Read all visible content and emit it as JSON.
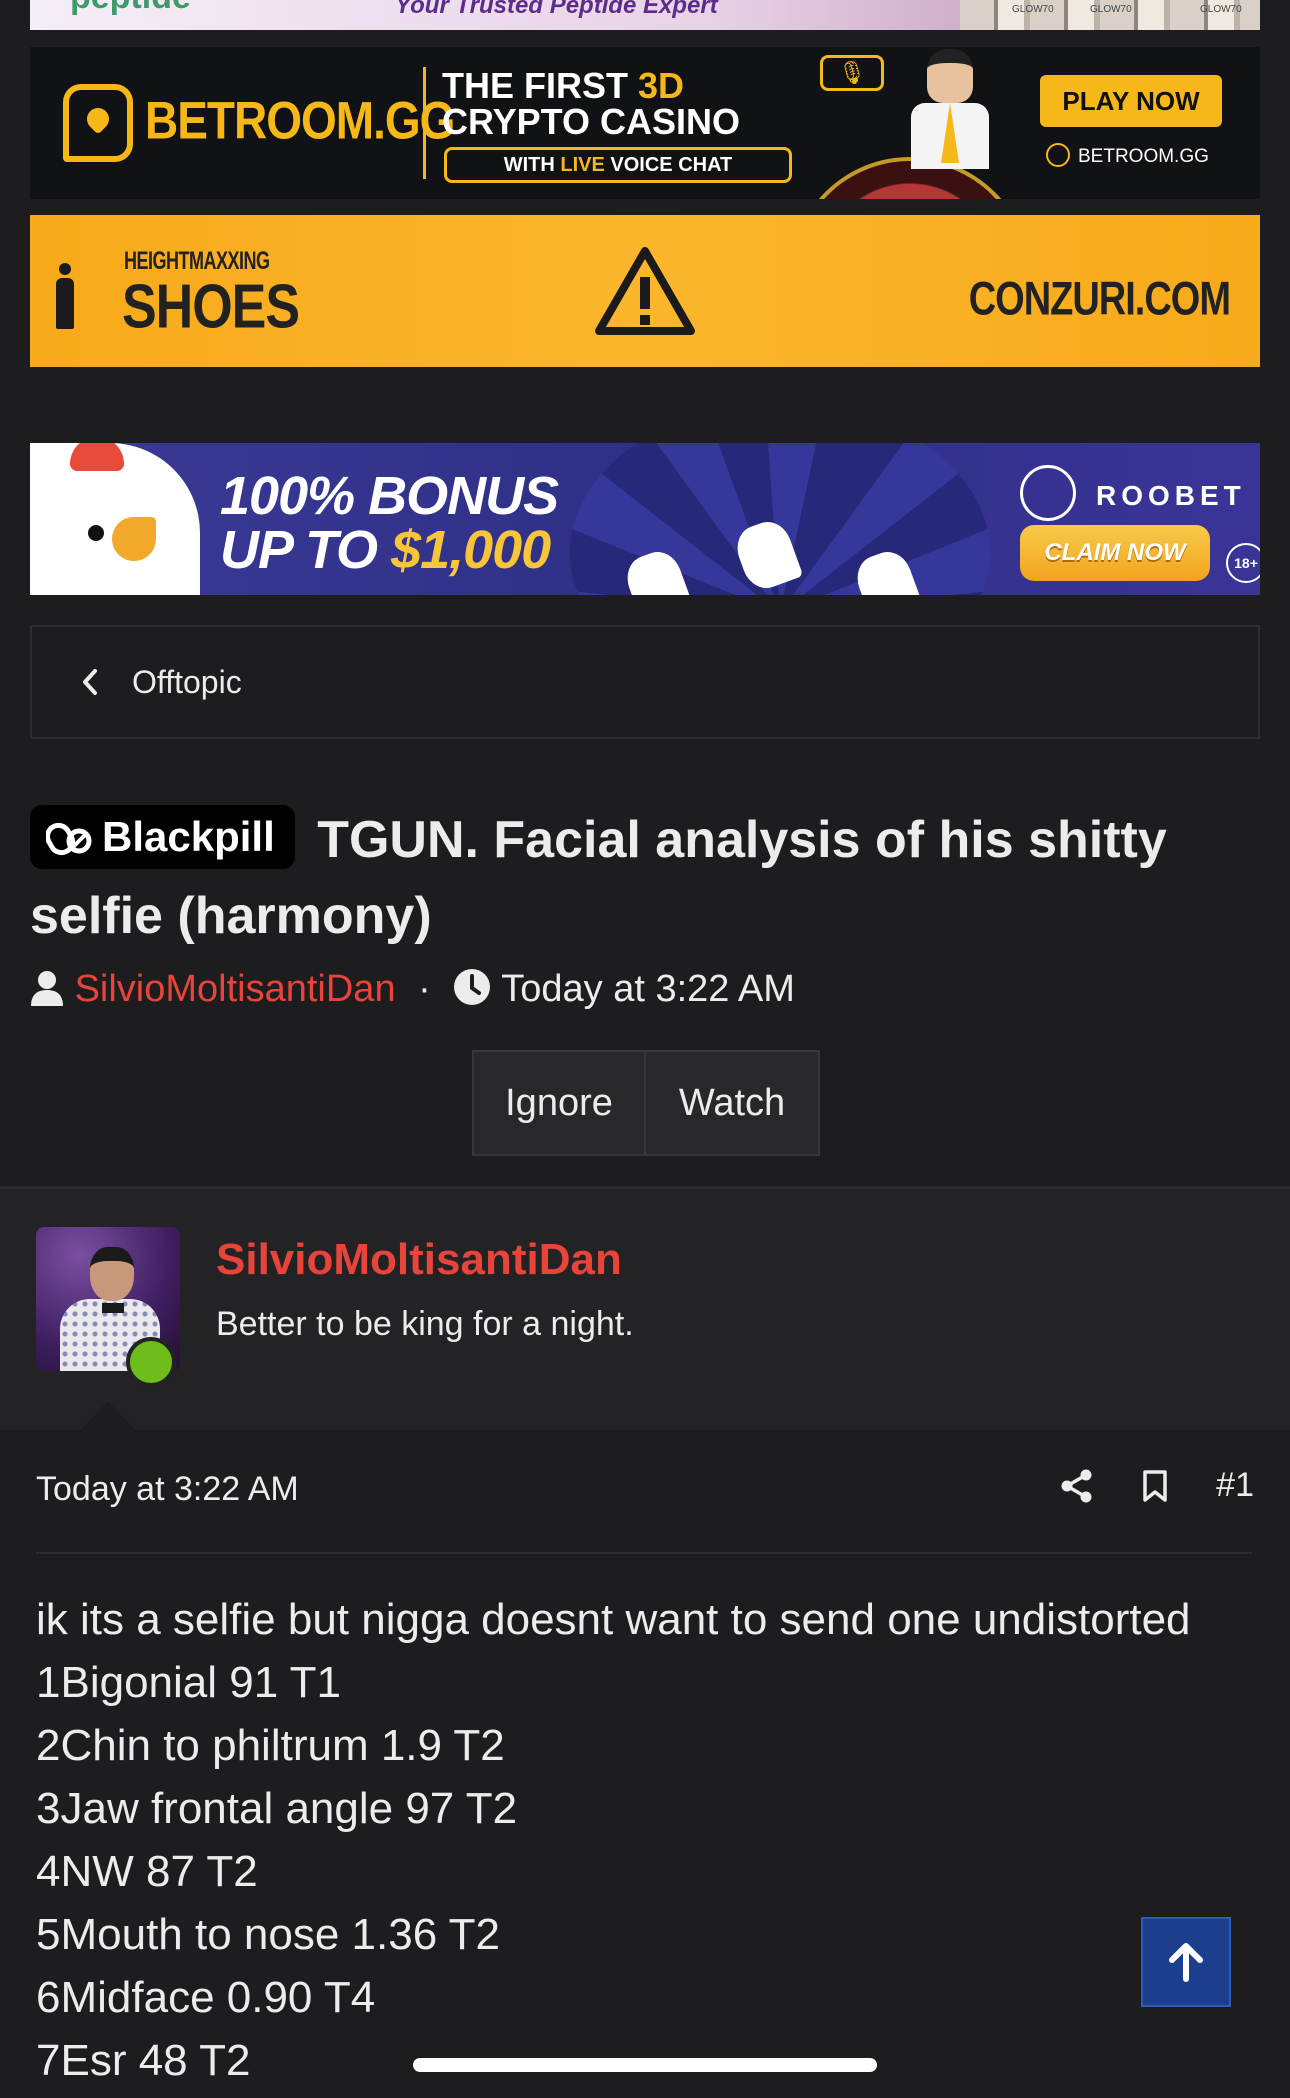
{
  "ads": {
    "peptide": {
      "logo": "peptide",
      "tagline": "Your Trusted Peptide Expert",
      "box_labels": [
        "GLOW70",
        "GLOW70",
        "GLOW70"
      ]
    },
    "betroom": {
      "brand": "BETROOM.GG",
      "headline_1": "THE FIRST",
      "headline_1_accent": "3D",
      "headline_2": "CRYPTO CASINO",
      "pill_pre": "WITH",
      "pill_accent": "LIVE",
      "pill_post": "VOICE CHAT",
      "cta": "PLAY NOW",
      "site": "BETROOM.GG",
      "accent_color": "#f6b719"
    },
    "conzuri": {
      "small_text": "HEIGHTMAXXING",
      "big_text": "SHOES",
      "site": "CONZURI.COM",
      "icon": "warning-triangle-icon",
      "bg_color": "#f7aa1a"
    },
    "roobet": {
      "headline_1": "100% BONUS",
      "headline_2_pre": "UP TO",
      "headline_2_accent": "$1,000",
      "brand": "ROOBET",
      "cta": "CLAIM NOW",
      "age_badge": "18+"
    }
  },
  "breadcrumb": {
    "label": "Offtopic",
    "icon": "chevron-left-icon"
  },
  "thread": {
    "prefix": "Blackpill",
    "prefix_icon": "pill-icon",
    "title": "TGUN. Facial analysis of his shitty selfie (harmony)",
    "author": "SilvioMoltisantiDan",
    "separator": "·",
    "date": "Today at 3:22 AM",
    "author_color": "#e8443a",
    "buttons": {
      "ignore": "Ignore",
      "watch": "Watch"
    }
  },
  "post": {
    "username": "SilvioMoltisantiDan",
    "user_title": "Better to be king for a night.",
    "online_status_color": "#6ebd1a",
    "date": "Today at 3:22 AM",
    "number": "#1",
    "lines": [
      "ik its a selfie but nigga doesnt want to send one undistorted",
      "1Bigonial 91 T1",
      "2Chin to philtrum 1.9 T2",
      "3Jaw frontal angle 97 T2",
      "4NW 87 T2",
      "5Mouth to nose 1.36 T2",
      "6Midface 0.90 T4",
      "7Esr 48 T2"
    ]
  },
  "back_to_top_icon": "arrow-up-icon"
}
